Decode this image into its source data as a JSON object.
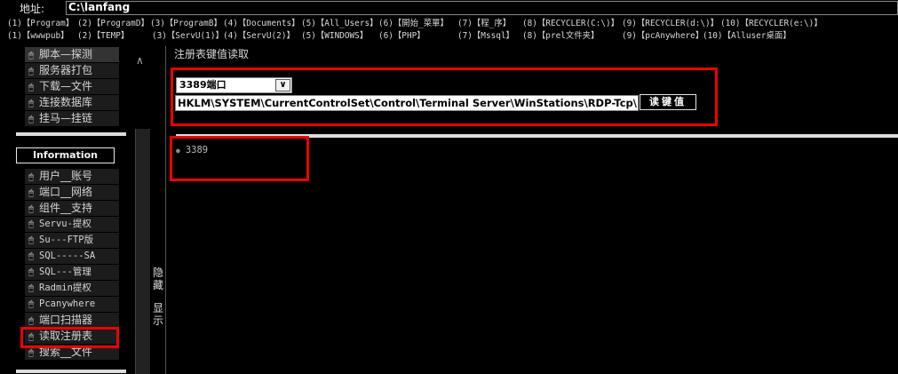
{
  "address": {
    "label": "地址:",
    "value": "C:\\lanfang"
  },
  "quicklinks": {
    "row1": [
      "(1)【Program】",
      "(2)【ProgramD】",
      "(3)【ProgramB】",
      "(4)【Documents】",
      "(5)【All_Users】",
      "(6)【開始_菜單】",
      "(7)【程_序】",
      "(8)【RECYCLER(C:\\)】",
      "(9)【RECYCLER(d:\\)】",
      "(10)【RECYCLER(e:\\)】"
    ],
    "row2": [
      "(1)【wwwpub】",
      "(2)【TEMP】",
      "(3)【ServU(1)】",
      "(4)【ServU(2)】",
      "(5)【WINDOWS】",
      "(6)【PHP】",
      "(7)【Mssql】",
      "(8)【prel文件夹】",
      "(9)【pcAnywhere】",
      "(10)【Alluser桌面】"
    ]
  },
  "sidebar": {
    "top_items": [
      "脚本—探测",
      "服务器打包",
      "下载—文件",
      "连接数据库",
      "挂马—挂链"
    ],
    "info_button": "Information",
    "bottom_items": [
      "用户__账号",
      "端口__网络",
      "组件__支持",
      "Servu-提权",
      "Su---FTP版",
      "SQL-----SA",
      "SQL---管理",
      "Radmin提权",
      "Pcanywhere",
      "端口扫描器",
      "读取注册表",
      "搜索__文件"
    ],
    "mouse_icon": "mouse-icon"
  },
  "toggle": {
    "hide": "隐藏",
    "show": "显示"
  },
  "main": {
    "title": "注册表键值读取",
    "port_select": "3389端口",
    "reg_path": "HKLM\\SYSTEM\\CurrentControlSet\\Control\\Terminal Server\\WinStations\\RDP-Tcp\\PortNumber",
    "read_button": "读键值",
    "result": "3389"
  },
  "colors": {
    "highlight": "#e00000",
    "bg": "#000000",
    "separator": "#dddddd"
  }
}
